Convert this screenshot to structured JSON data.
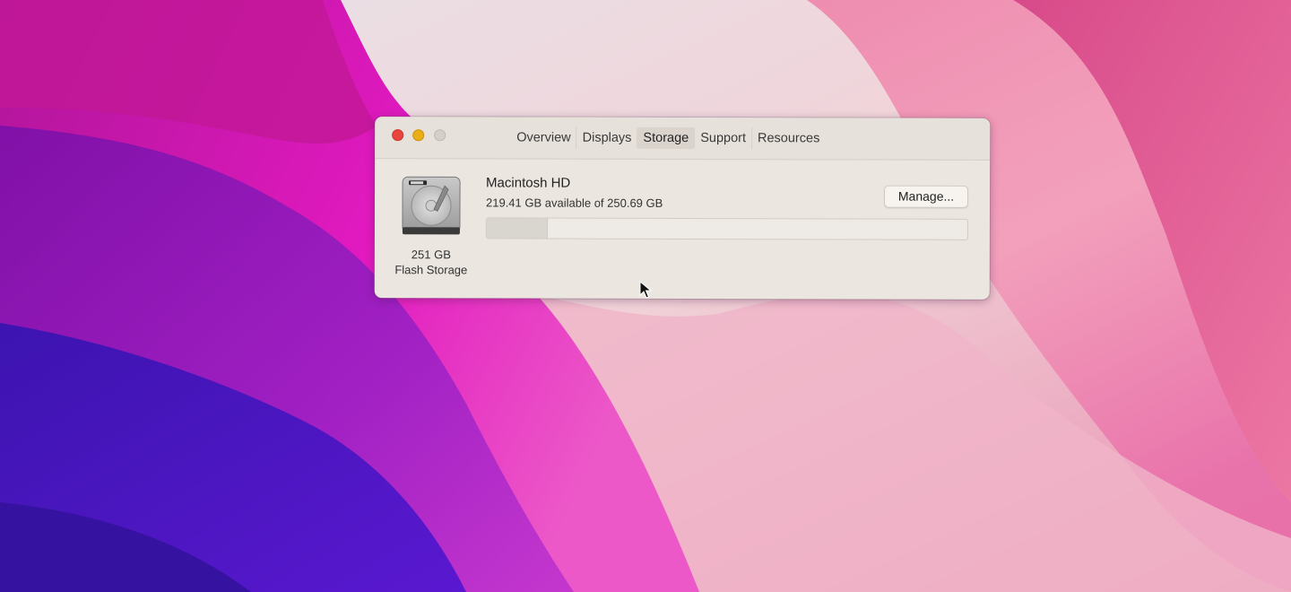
{
  "window": {
    "tabs": [
      {
        "label": "Overview",
        "active": false
      },
      {
        "label": "Displays",
        "active": false
      },
      {
        "label": "Storage",
        "active": true
      },
      {
        "label": "Support",
        "active": false
      },
      {
        "label": "Resources",
        "active": false
      }
    ]
  },
  "storage": {
    "drive_size": "251 GB",
    "drive_type": "Flash Storage",
    "volume_name": "Macintosh HD",
    "volume_detail": "219.41 GB available of 250.69 GB",
    "manage_label": "Manage...",
    "used_fraction": 0.125
  },
  "colors": {
    "close": "#e8463f",
    "minimize": "#e9ae18",
    "zoom_disabled": "#d3cfca",
    "window_bg": "#ebe6df"
  },
  "icons": {
    "drive": "hard-drive-icon",
    "cursor": "mouse-pointer-icon"
  }
}
